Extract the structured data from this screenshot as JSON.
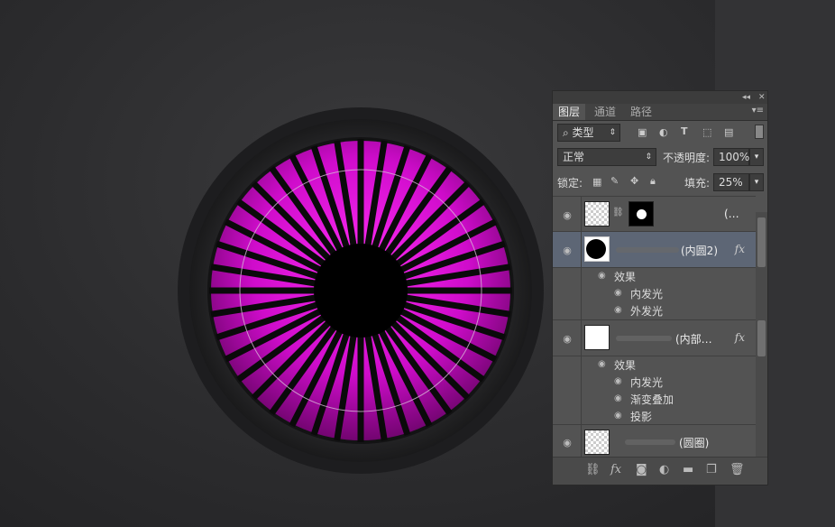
{
  "panel": {
    "tabs": [
      {
        "label": "图层",
        "active": true
      },
      {
        "label": "通道",
        "active": false
      },
      {
        "label": "路径",
        "active": false
      }
    ],
    "filter": {
      "label": "类型"
    },
    "blend_mode": "正常",
    "opacity_label": "不透明度:",
    "opacity_value": "100%",
    "lock_label": "锁定:",
    "fill_label": "填充:",
    "fill_value": "25%",
    "layers": [
      {
        "name": "(…",
        "selected": false
      },
      {
        "name": "(内圆2)",
        "selected": true,
        "has_fx": true,
        "effects_label": "效果",
        "effects": [
          "内发光",
          "外发光"
        ]
      },
      {
        "name": "(内部…",
        "selected": false,
        "has_fx": true,
        "effects_label": "效果",
        "effects": [
          "内发光",
          "渐变叠加",
          "投影"
        ]
      },
      {
        "name": "(圆圈)",
        "selected": false
      }
    ],
    "fx_label": "fx"
  },
  "colors": {
    "accent_magenta": "#e010d8",
    "selection_blue": "#5d6675",
    "panel_bg": "#535353"
  },
  "icons": [
    "search-icon",
    "image-filter-icon",
    "adjustment-filter-icon",
    "text-filter-icon",
    "shape-filter-icon",
    "smart-object-filter-icon",
    "lock-pixels-icon",
    "lock-brush-icon",
    "lock-move-icon",
    "lock-all-icon",
    "eye-icon",
    "link-icon",
    "fx-icon",
    "mask-icon",
    "new-group-icon",
    "new-layer-icon",
    "trash-icon"
  ]
}
